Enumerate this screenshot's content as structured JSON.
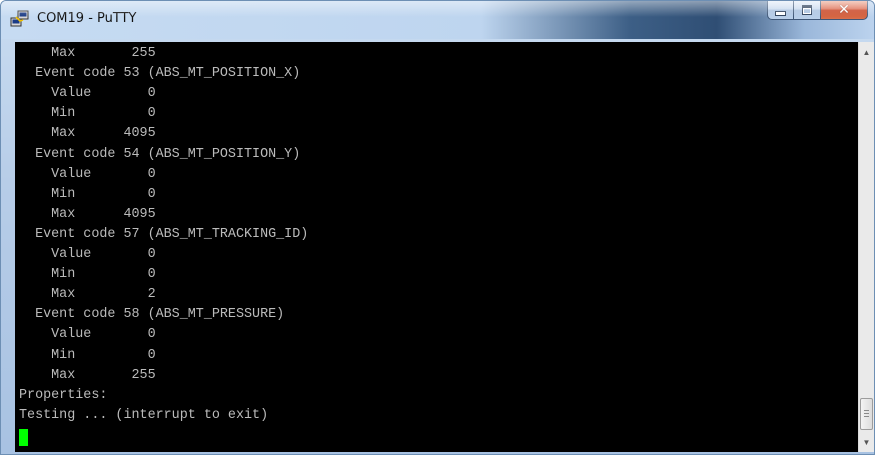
{
  "window": {
    "title": "COM19 - PuTTY",
    "icon": "putty-icon"
  },
  "controls": {
    "minimize_icon": "minimize-icon",
    "maximize_icon": "maximize-icon",
    "close_label": "✕"
  },
  "terminal": {
    "lines": [
      "    Max       255",
      "  Event code 53 (ABS_MT_POSITION_X)",
      "    Value       0",
      "    Min         0",
      "    Max      4095",
      "  Event code 54 (ABS_MT_POSITION_Y)",
      "    Value       0",
      "    Min         0",
      "    Max      4095",
      "  Event code 57 (ABS_MT_TRACKING_ID)",
      "    Value       0",
      "    Min         0",
      "    Max         2",
      "  Event code 58 (ABS_MT_PRESSURE)",
      "    Value       0",
      "    Min         0",
      "    Max       255",
      "Properties:",
      "Testing ... (interrupt to exit)"
    ],
    "cursor_color": "#00ff00",
    "text_color": "#bbbbbb",
    "background": "#000000"
  },
  "scrollbar": {
    "up_arrow": "▲",
    "down_arrow": "▼"
  }
}
